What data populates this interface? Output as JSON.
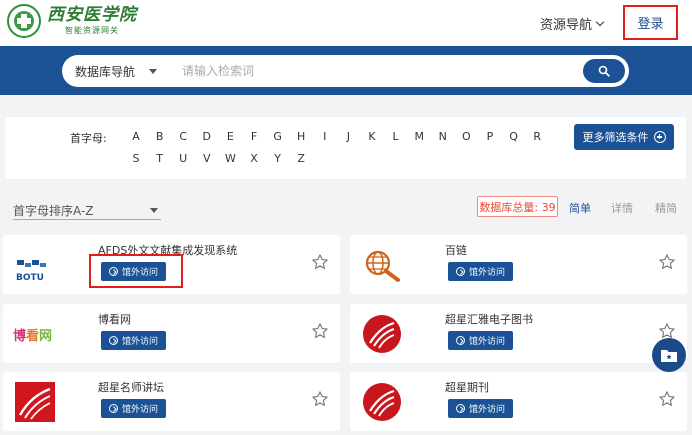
{
  "header": {
    "logo_title": "西安医学院",
    "logo_sub": "智能资源网关",
    "nav_menu_label": "资源导航",
    "login_label": "登录"
  },
  "search": {
    "select_label": "数据库导航",
    "placeholder": "请输入检索词"
  },
  "filter": {
    "label": "首字母:",
    "letters": [
      "A",
      "B",
      "C",
      "D",
      "E",
      "F",
      "G",
      "H",
      "I",
      "J",
      "K",
      "L",
      "M",
      "N",
      "O",
      "P",
      "Q",
      "R",
      "S",
      "T",
      "U",
      "V",
      "W",
      "X",
      "Y",
      "Z"
    ],
    "more_label": "更多筛选条件"
  },
  "sort": {
    "selected": "首字母排序A-Z",
    "total_label": "数据库总量: 39",
    "views": [
      "简单",
      "详情",
      "精简"
    ]
  },
  "databases": [
    {
      "name": "AFDS外文文献集成发现系统",
      "button": "馆外访问",
      "logo": "botu-logo"
    },
    {
      "name": "百链",
      "button": "馆外访问",
      "logo": "globe-magnifier-logo"
    },
    {
      "name": "博看网",
      "button": "馆外访问",
      "logo": "bookan-logo"
    },
    {
      "name": "超星汇雅电子图书",
      "button": "馆外访问",
      "logo": "chaoxing-logo"
    },
    {
      "name": "超星名师讲坛",
      "button": "馆外访问",
      "logo": "chaoxing-square-logo"
    },
    {
      "name": "超星期刊",
      "button": "馆外访问",
      "logo": "chaoxing-logo"
    }
  ],
  "colors": {
    "primary": "#1b5195",
    "highlight_border": "#e21d1d",
    "logo_green": "#2d7d36"
  }
}
